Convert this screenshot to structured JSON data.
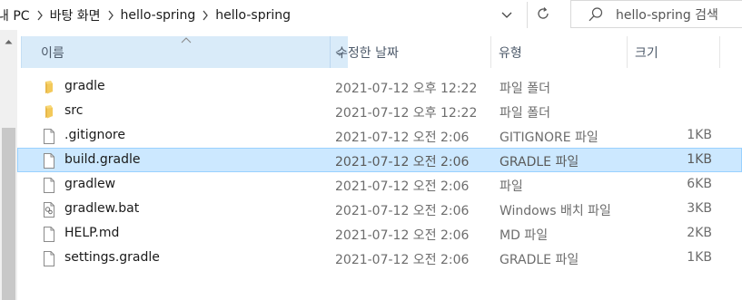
{
  "address": {
    "breadcrumbs": [
      "내 PC",
      "바탕 화면",
      "hello-spring",
      "hello-spring"
    ]
  },
  "search": {
    "placeholder": "hello-spring 검색"
  },
  "columns": {
    "name": "이름",
    "date": "수정한 날짜",
    "type": "유형",
    "size": "크기"
  },
  "files": [
    {
      "name": "gradle",
      "date": "2021-07-12 오후 12:22",
      "type": "파일 폴더",
      "size": "",
      "icon": "folder-icon"
    },
    {
      "name": "src",
      "date": "2021-07-12 오후 12:22",
      "type": "파일 폴더",
      "size": "",
      "icon": "folder-icon"
    },
    {
      "name": ".gitignore",
      "date": "2021-07-12 오전 2:06",
      "type": "GITIGNORE 파일",
      "size": "1KB",
      "icon": "file-icon"
    },
    {
      "name": "build.gradle",
      "date": "2021-07-12 오전 2:06",
      "type": "GRADLE 파일",
      "size": "1KB",
      "icon": "file-icon",
      "selected": true
    },
    {
      "name": "gradlew",
      "date": "2021-07-12 오전 2:06",
      "type": "파일",
      "size": "6KB",
      "icon": "file-icon"
    },
    {
      "name": "gradlew.bat",
      "date": "2021-07-12 오전 2:06",
      "type": "Windows 배치 파일",
      "size": "3KB",
      "icon": "batch-file-icon"
    },
    {
      "name": "HELP.md",
      "date": "2021-07-12 오전 2:06",
      "type": "MD 파일",
      "size": "2KB",
      "icon": "file-icon"
    },
    {
      "name": "settings.gradle",
      "date": "2021-07-12 오전 2:06",
      "type": "GRADLE 파일",
      "size": "1KB",
      "icon": "file-icon"
    }
  ],
  "colors": {
    "selection": "#cce8ff",
    "selection_border": "#99d1ff",
    "header_highlight": "#d9ebf9",
    "folder": "#f8d775"
  }
}
